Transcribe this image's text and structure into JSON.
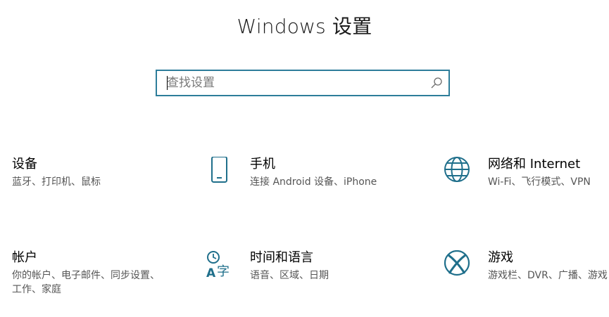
{
  "header": {
    "title": "Windows 设置"
  },
  "search": {
    "placeholder": "查找设置",
    "value": ""
  },
  "tiles": [
    {
      "name": "设备",
      "desc": "蓝牙、打印机、鼠标",
      "icon": "devices-icon"
    },
    {
      "name": "手机",
      "desc": "连接 Android 设备、iPhone",
      "icon": "phone-icon"
    },
    {
      "name": "网络和 Internet",
      "desc": "Wi-Fi、飞行模式、VPN",
      "icon": "globe-icon"
    },
    {
      "name": "帐户",
      "desc": "你的帐户、电子邮件、同步设置、工作、家庭",
      "icon": "accounts-icon"
    },
    {
      "name": "时间和语言",
      "desc": "语音、区域、日期",
      "icon": "time-language-icon"
    },
    {
      "name": "游戏",
      "desc": "游戏栏、DVR、广播、游戏",
      "icon": "xbox-icon"
    }
  ],
  "colors": {
    "accent": "#2d7d9a",
    "icon": "#1f6f8b",
    "desc_text": "#555555"
  }
}
